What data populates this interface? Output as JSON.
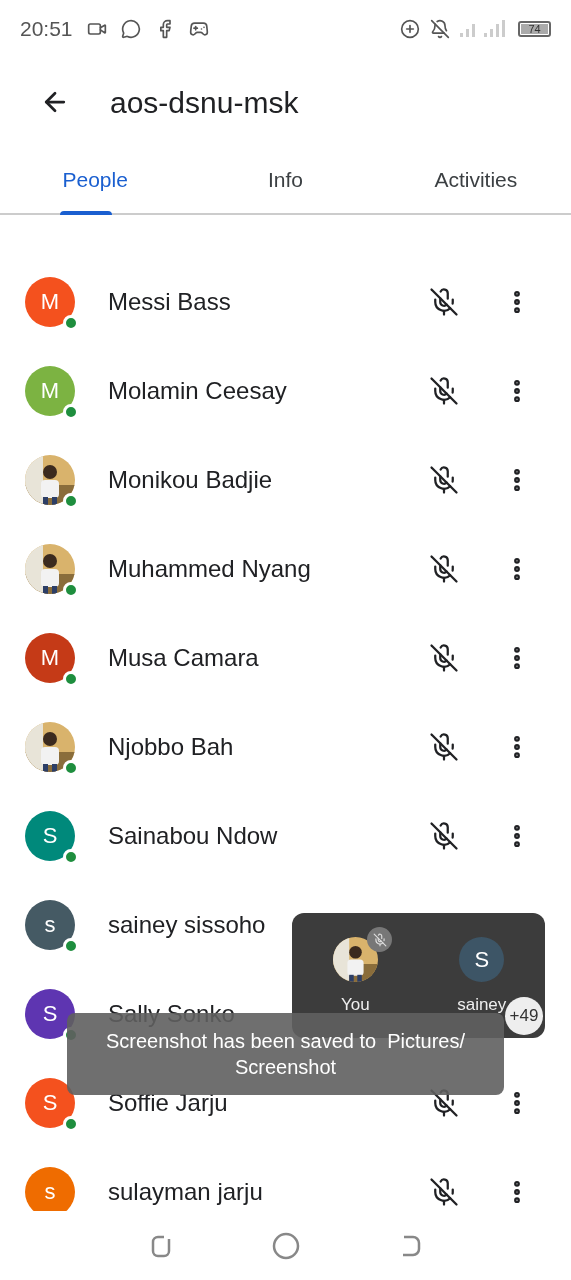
{
  "status_bar": {
    "time": "20:51",
    "battery": "74"
  },
  "header": {
    "title": "aos-dsnu-msk"
  },
  "tabs": [
    {
      "label": "People",
      "selected": true
    },
    {
      "label": "Info",
      "selected": false
    },
    {
      "label": "Activities",
      "selected": false
    }
  ],
  "participants": [
    {
      "name": "Messi Bass",
      "avatar": {
        "kind": "letter",
        "letter": "M",
        "color": "#f4511e"
      },
      "online": true,
      "covered": false
    },
    {
      "name": "Molamin Ceesay",
      "avatar": {
        "kind": "letter",
        "letter": "M",
        "color": "#7cb342"
      },
      "online": true,
      "covered": false
    },
    {
      "name": "Monikou Badjie",
      "online": true,
      "covered": false
    },
    {
      "name": "Muhammed Nyang",
      "online": true,
      "covered": false
    },
    {
      "name": "Musa Camara",
      "avatar": {
        "kind": "letter",
        "letter": "M",
        "color": "#c53a17"
      },
      "online": true,
      "covered": false
    },
    {
      "name": "Njobbo Bah",
      "online": true,
      "covered": false
    },
    {
      "name": "Sainabou Ndow",
      "avatar": {
        "kind": "letter",
        "letter": "S",
        "color": "#00897b"
      },
      "online": true,
      "covered": false
    },
    {
      "name": "sainey sissoho",
      "avatar": {
        "kind": "letter",
        "letter": "s",
        "color": "#455a64"
      },
      "online": true,
      "covered": true
    },
    {
      "name": "Sally Sonko",
      "avatar": {
        "kind": "letter",
        "letter": "S",
        "color": "#5e35b1"
      },
      "online": true,
      "covered": true
    },
    {
      "name": "Soffie Jarju",
      "avatar": {
        "kind": "letter",
        "letter": "S",
        "color": "#f4511e"
      },
      "online": true,
      "covered": false
    },
    {
      "name": "sulayman jarju",
      "avatar": {
        "kind": "letter",
        "letter": "s",
        "color": "#ef6c00"
      },
      "online": false,
      "covered": false
    }
  ],
  "call_panel": {
    "tiles": [
      {
        "label": "You",
        "muted": true
      },
      {
        "label": "sainey",
        "avatar": {
          "kind": "letter",
          "letter": "S",
          "color": "#3d5566"
        },
        "muted": false
      }
    ],
    "more_count": "+49"
  },
  "toast": {
    "text": "Screenshot has been saved to  Pictures/ Screenshot"
  }
}
